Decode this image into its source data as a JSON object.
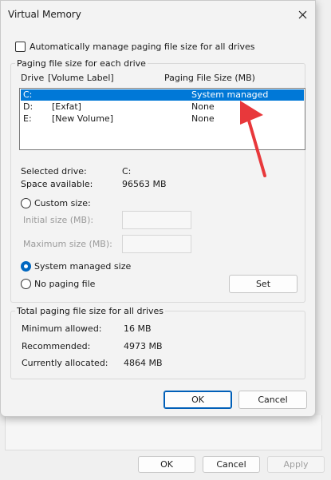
{
  "dialog": {
    "title": "Virtual Memory",
    "auto_manage_label": "Automatically manage paging file size for all drives",
    "paging_group_title": "Paging file size for each drive",
    "header": {
      "drive": "Drive",
      "volume_label": "[Volume Label]",
      "paging_size": "Paging File Size (MB)"
    },
    "drives": [
      {
        "drive": "C:",
        "label": "",
        "size": "System managed",
        "selected": true
      },
      {
        "drive": "D:",
        "label": "[Exfat]",
        "size": "None",
        "selected": false
      },
      {
        "drive": "E:",
        "label": "[New Volume]",
        "size": "None",
        "selected": false
      }
    ],
    "selected_drive_label": "Selected drive:",
    "selected_drive_value": "C:",
    "space_available_label": "Space available:",
    "space_available_value": "96563 MB",
    "custom_size_label": "Custom size:",
    "initial_size_label": "Initial size (MB):",
    "maximum_size_label": "Maximum size (MB):",
    "system_managed_label": "System managed size",
    "no_paging_label": "No paging file",
    "set_label": "Set",
    "total_group_title": "Total paging file size for all drives",
    "min_allowed_label": "Minimum allowed:",
    "min_allowed_value": "16 MB",
    "recommended_label": "Recommended:",
    "recommended_value": "4973 MB",
    "currently_allocated_label": "Currently allocated:",
    "currently_allocated_value": "4864 MB",
    "ok_label": "OK",
    "cancel_label": "Cancel"
  },
  "background": {
    "ok_label": "OK",
    "cancel_label": "Cancel",
    "apply_label": "Apply"
  },
  "colors": {
    "selection": "#0078d7",
    "accent": "#005fb8",
    "annotation_arrow": "#e8383b"
  }
}
